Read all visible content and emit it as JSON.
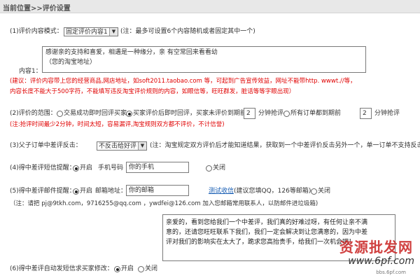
{
  "header": {
    "breadcrumb": "当前位置>>评价设置"
  },
  "s1": {
    "label": "(1)评价内容模式：",
    "select_value": "固定评价内容1",
    "note": "(注：最多可设置6个内容随机或者固定其中一个)",
    "content_label": "内容1：",
    "content_line1": "感谢亲的支持和喜爱，相遇是一种缘分，亲 有空常回来看看幼",
    "content_line2": "（您的淘宝地址）",
    "tip_line1": "(建议：评价内容带上您的经营商品,网店地址，如soft2011.taobao.com 等，可起到广告宣传效益，网址不能带http. wwwt.//等，",
    "tip_line2": "内容长度不能大于500字符，不能填写违反淘宝评价规则的内容，如眼信等，旺旺群发，脏话等等字眼出现）"
  },
  "s2": {
    "label": "(2)评价的范围：",
    "opt1": "交易成功即时回评买家",
    "opt2": "买家评价后即时回评，买家未评价到期前",
    "input1": "2",
    "unit1": "分钟抢评",
    "opt3": "所有订单都到期前",
    "input2": "2",
    "unit2": "分钟抢评",
    "note": "(注:抢评时间最少2分钟，时间太短，容易漏评,淘宝规则双方都不评价，不计信誉)"
  },
  "s3": {
    "label": "(3)父子订单中差评反击：",
    "select_value": "不反击给好评",
    "note": "(注：淘宝规定双方评价后才能知道结果，获取到一个中差评价反击另外一个，单一订单不支持反击)"
  },
  "s4": {
    "label": "(4)得中差评短信提醒：",
    "on": "开启",
    "phone_label": "手机号码",
    "phone_value": "你的手机",
    "off": "关闭"
  },
  "s5": {
    "label": "(5)得中差评邮件提醒：",
    "on": "开启",
    "email_label": "邮箱地址：",
    "email_value": "你的邮箱",
    "test_link": "测试收信",
    "suggest": "(建议您填QQ，126等邮箱)",
    "off": "关闭",
    "note": "（注：请把 pj@9tkh.com，9716255@qq.com        ，ywdfei@126.com 加入您邮箱常用联系人，以防邮件进垃圾箱)"
  },
  "reply_box": {
    "line1": "亲爱的，看到您给我们一个中差评，我们真的好难过呀，有任何让亲不满",
    "line2": "意的，还请您旺旺联系下我们，我们一定会解决到让您满意的，因为中差",
    "line3": "评对我们的影响实在太大了，跪求您高抬贵手，给我们一次机会吧！"
  },
  "s6": {
    "label": "(6)得中差评自动发短信求买家修改：",
    "on": "开启",
    "off": "关闭"
  },
  "watermark": {
    "text1": "资源批发网",
    "text2": "www.6pf.com",
    "text3": "bbs.6pf.com"
  }
}
